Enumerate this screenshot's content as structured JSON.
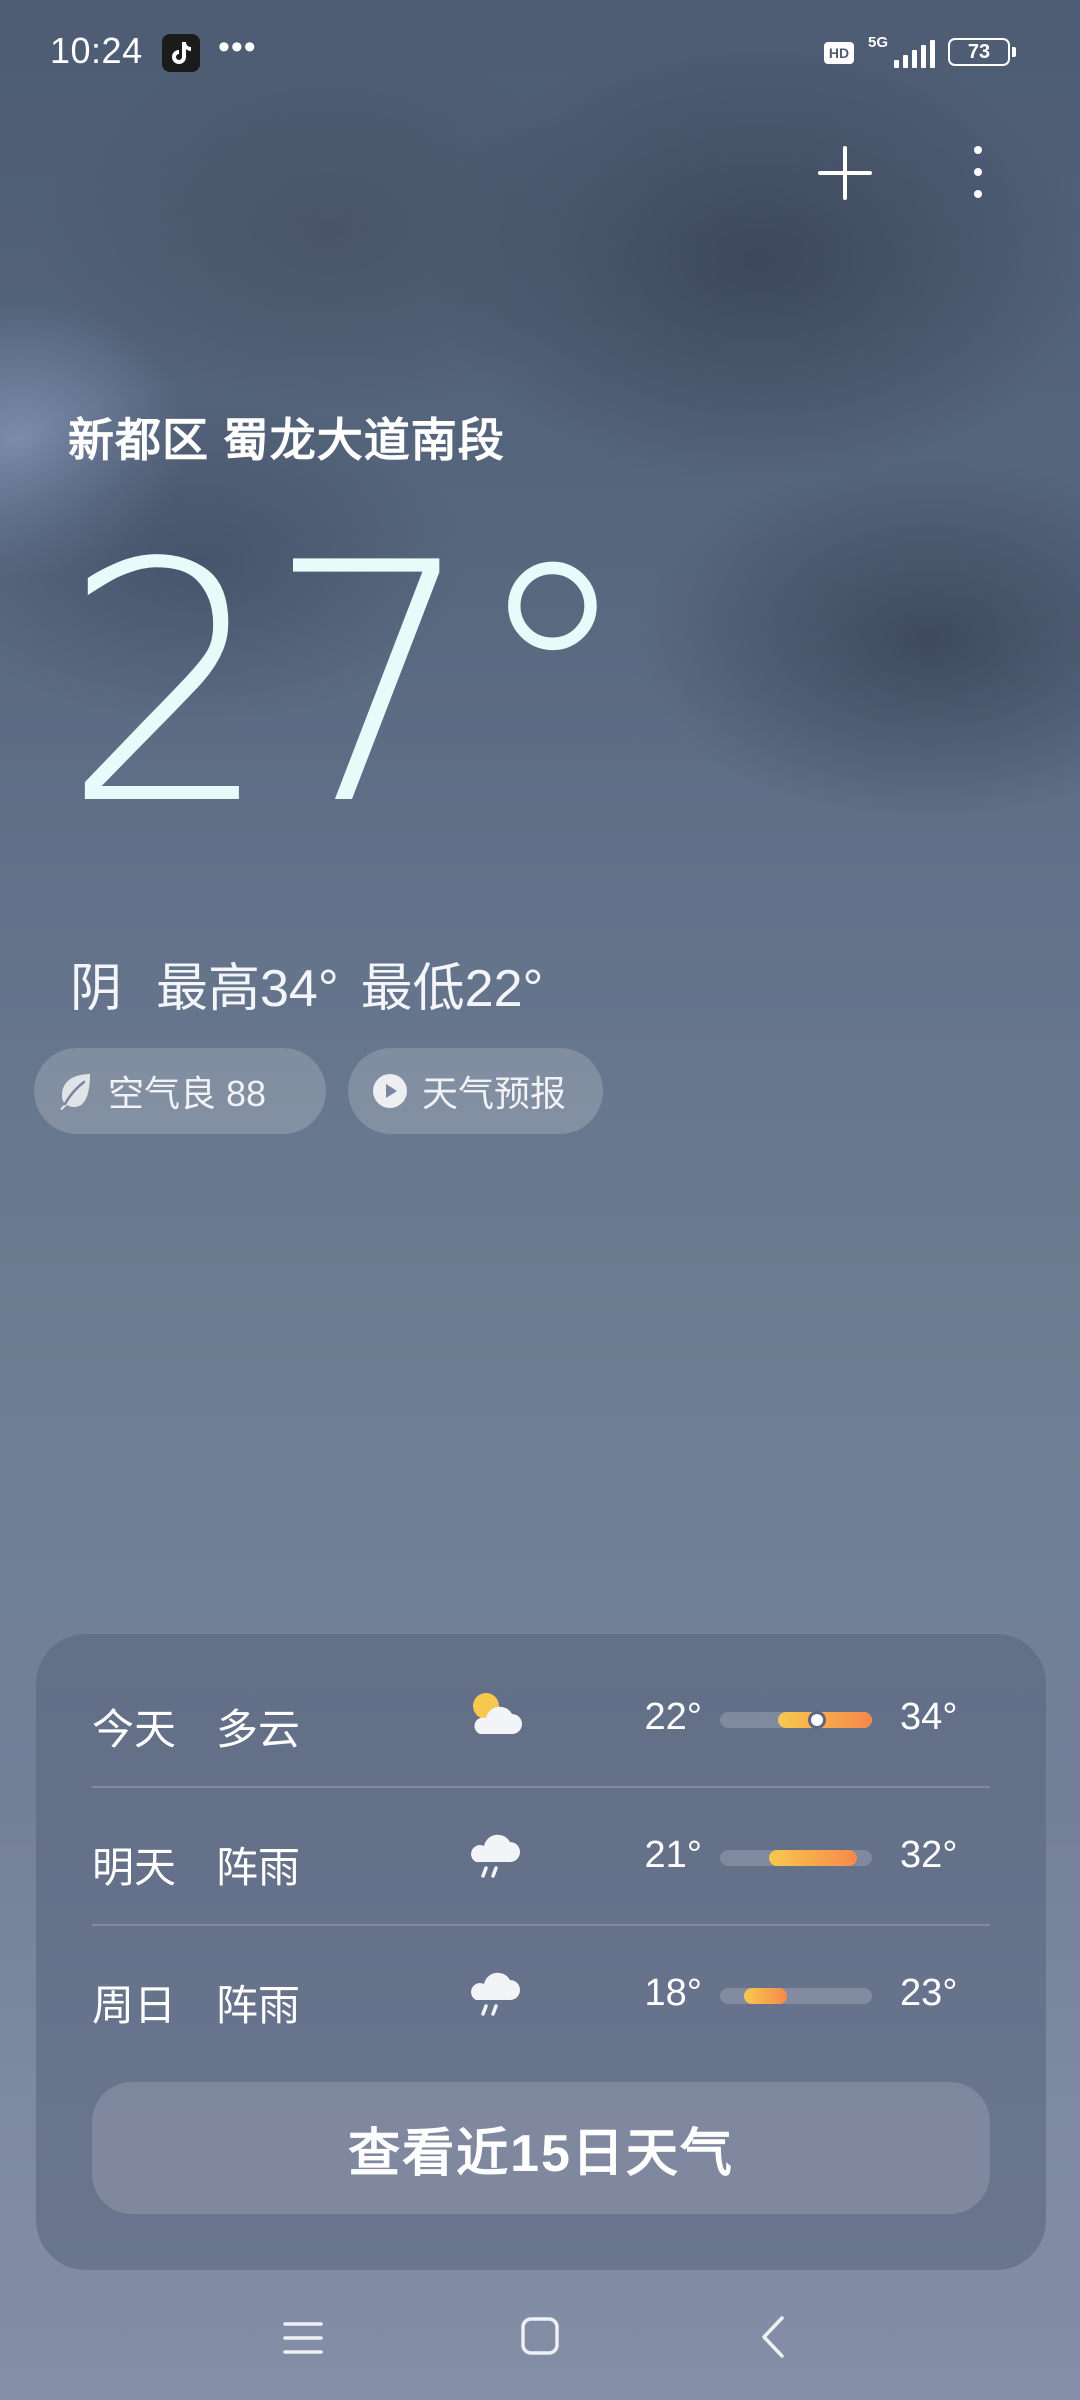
{
  "status_bar": {
    "time": "10:24",
    "more_dots": "•••",
    "hd": "HD",
    "network": "5G",
    "battery": "73"
  },
  "location": "新都区 蜀龙大道南段",
  "current": {
    "temperature": "27°",
    "condition": "阴",
    "high": "最高34°",
    "low": "最低22°"
  },
  "pills": {
    "air_quality": "空气良 88",
    "forecast_video": "天气预报"
  },
  "forecast": [
    {
      "day": "今天",
      "condition": "多云",
      "icon": "partly-cloudy-icon",
      "low": "22°",
      "high": "34°",
      "bar_start": 0.38,
      "bar_end": 1.0,
      "current_marker": 0.64
    },
    {
      "day": "明天",
      "condition": "阵雨",
      "icon": "shower-icon",
      "low": "21°",
      "high": "32°",
      "bar_start": 0.32,
      "bar_end": 0.9
    },
    {
      "day": "周日",
      "condition": "阵雨",
      "icon": "shower-icon",
      "low": "18°",
      "high": "23°",
      "bar_start": 0.16,
      "bar_end": 0.44
    }
  ],
  "forecast_button": "查看近15日天气",
  "colors": {
    "bar_gradient_start": "#f7c84e",
    "bar_gradient_end": "#f7894a",
    "temperature_text": "#e8fbfb"
  }
}
